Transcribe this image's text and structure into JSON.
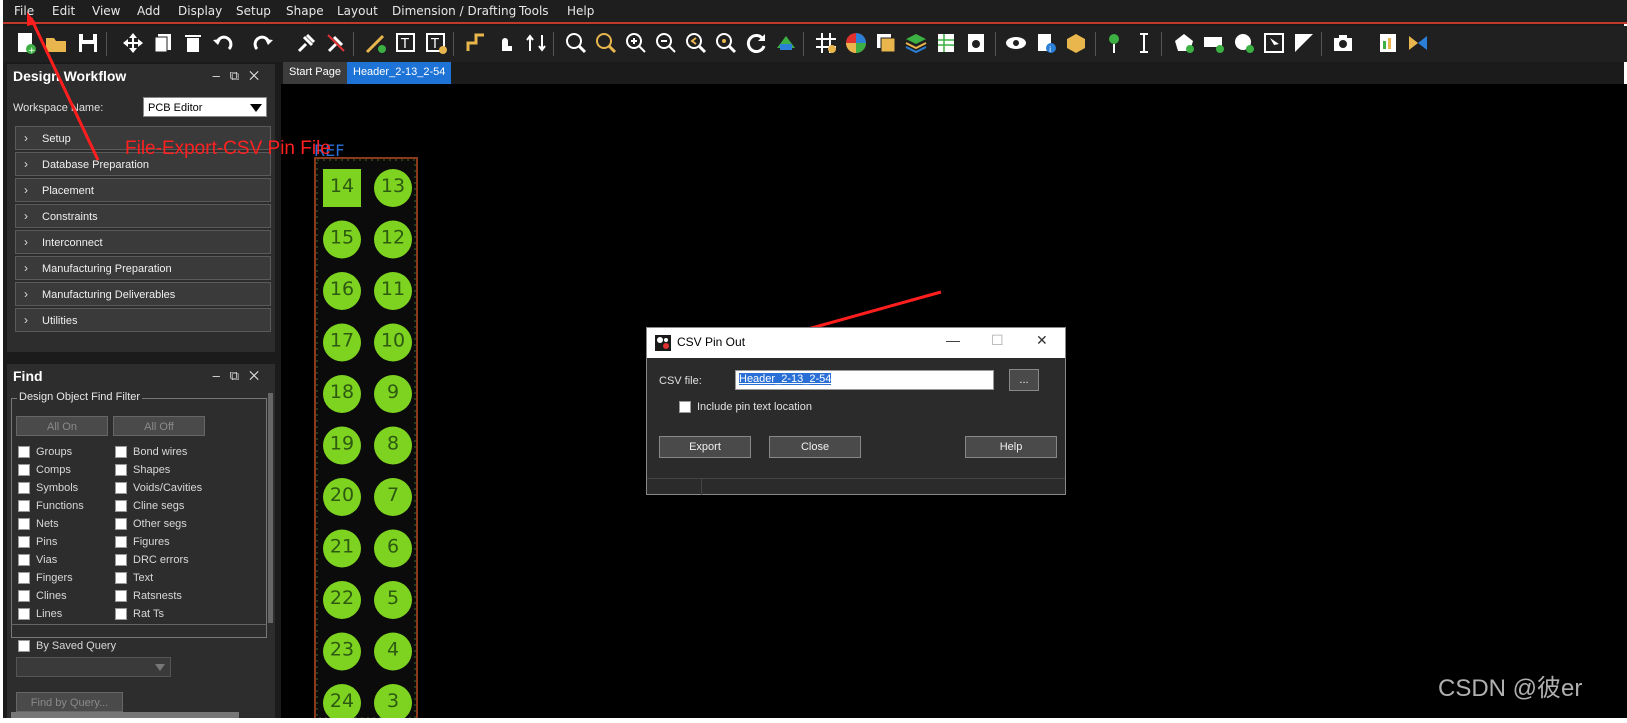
{
  "menu": [
    "File",
    "Edit",
    "View",
    "Add",
    "Display",
    "Setup",
    "Shape",
    "Layout",
    "Dimension / Drafting",
    "Tools",
    "Help"
  ],
  "design_workflow": {
    "title": "Design Workflow",
    "workspace_label": "Workspace Name:",
    "workspace_value": "PCB Editor",
    "items": [
      "Setup",
      "Database Preparation",
      "Placement",
      "Constraints",
      "Interconnect",
      "Manufacturing Preparation",
      "Manufacturing Deliverables",
      "Utilities"
    ]
  },
  "find": {
    "title": "Find",
    "filter_legend": "Design Object Find Filter",
    "all_on": "All On",
    "all_off": "All Off",
    "left_items": [
      "Groups",
      "Comps",
      "Symbols",
      "Functions",
      "Nets",
      "Pins",
      "Vias",
      "Fingers",
      "Clines",
      "Lines"
    ],
    "right_items": [
      "Bond wires",
      "Shapes",
      "Voids/Cavities",
      "Cline segs",
      "Other segs",
      "Figures",
      "DRC errors",
      "Text",
      "Ratsnests",
      "Rat Ts"
    ],
    "by_saved_query": "By Saved Query",
    "find_by_query": "Find by Query..."
  },
  "tabs": [
    "Start Page",
    "Header_2-13_2-54"
  ],
  "pcb": {
    "refdes": "REF",
    "left_pins": [
      "14",
      "15",
      "16",
      "17",
      "18",
      "19",
      "20",
      "21",
      "22",
      "23",
      "24"
    ],
    "right_pins": [
      "13",
      "12",
      "11",
      "10",
      "9",
      "8",
      "7",
      "6",
      "5",
      "4",
      "3"
    ],
    "pad_color": "#7ed321"
  },
  "annotation": "File-Export-CSV Pin File",
  "dialog": {
    "title": "CSV Pin Out",
    "csv_label": "CSV file:",
    "csv_value": "Header_2-13_2-54",
    "browse": "...",
    "include_label": "Include pin text location",
    "export": "Export",
    "close": "Close",
    "help": "Help"
  },
  "watermark": "CSDN @彼er",
  "colors": {
    "accent": "#c0392b",
    "tab_active": "#1e73d6",
    "tab_inactive": "#3c3c3c",
    "annotation": "#ff2020"
  }
}
